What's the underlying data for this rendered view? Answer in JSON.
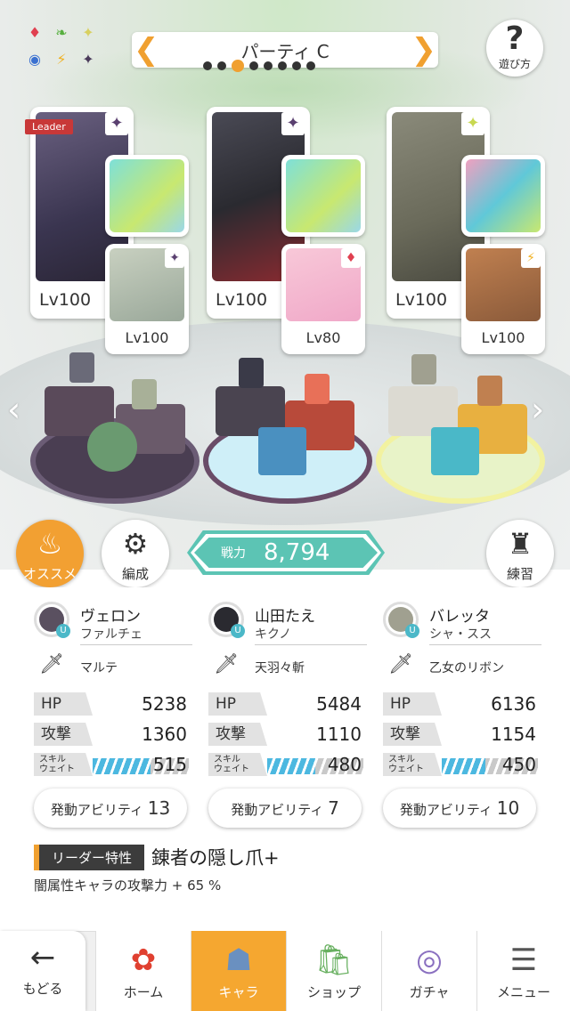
{
  "party": {
    "title": "パーティ C",
    "dots": 8,
    "active_dot": 2
  },
  "help": {
    "label": "遊び方"
  },
  "leader_badge": "Leader",
  "slots": [
    {
      "lv": "Lv100",
      "elem_icon": "✦",
      "sub_lv": "Lv100",
      "sub_elem_icon": "✦",
      "art": "#3a3550",
      "sub_art": "#9aa89a",
      "elem_color": "#5a4070",
      "sub_elem_color": "#5a4070"
    },
    {
      "lv": "Lv100",
      "elem_icon": "✦",
      "sub_lv": "Lv80",
      "sub_elem_icon": "♦",
      "art": "#2a2a30",
      "sub_art": "#f0a8c8",
      "elem_color": "#5a4070",
      "sub_elem_color": "#e04050"
    },
    {
      "lv": "Lv100",
      "elem_icon": "✦",
      "sub_lv": "Lv100",
      "sub_elem_icon": "⚡",
      "art": "#6a6a5a",
      "sub_art": "#8a5a3a",
      "elem_color": "#c8d850",
      "sub_elem_color": "#f0b020"
    }
  ],
  "buttons": {
    "osusume": "オススメ",
    "edit": "編成",
    "practice": "練習"
  },
  "power": {
    "label": "戦力",
    "value": "8,794"
  },
  "characters": [
    {
      "name": "ヴェロン",
      "weapon": "ファルチェ",
      "accessory": "マルテ",
      "hp": "5238",
      "atk": "1360",
      "skill": "515",
      "skill_fill": 0.6,
      "ability_label": "発動アビリティ",
      "ability_count": "13",
      "avatar": "#5a5060"
    },
    {
      "name": "山田たえ",
      "weapon": "キクノ",
      "accessory": "天羽々斬",
      "hp": "5484",
      "atk": "1110",
      "skill": "480",
      "skill_fill": 0.5,
      "ability_label": "発動アビリティ",
      "ability_count": "7",
      "avatar": "#2a2a30"
    },
    {
      "name": "バレッタ",
      "weapon": "シャ・スス",
      "accessory": "乙女のリボン",
      "hp": "6136",
      "atk": "1154",
      "skill": "450",
      "skill_fill": 0.45,
      "ability_label": "発動アビリティ",
      "ability_count": "10",
      "avatar": "#a0a090"
    }
  ],
  "stat_labels": {
    "hp": "HP",
    "atk": "攻撃",
    "skill_top": "スキル",
    "skill_bottom": "ウェイト"
  },
  "leader_trait": {
    "tag": "リーダー特性",
    "title": "錬者の隠し爪+",
    "desc": "闇属性キャラの攻撃力 + 65 %"
  },
  "nav": {
    "back": "もどる",
    "tabs": [
      "ホーム",
      "キャラ",
      "ショップ",
      "ガチャ",
      "メニュー"
    ],
    "active": "キャラ"
  },
  "colors": {
    "accent": "#f0a030",
    "power": "#5cc4b4",
    "skill_bar": "#4cb8e0"
  }
}
